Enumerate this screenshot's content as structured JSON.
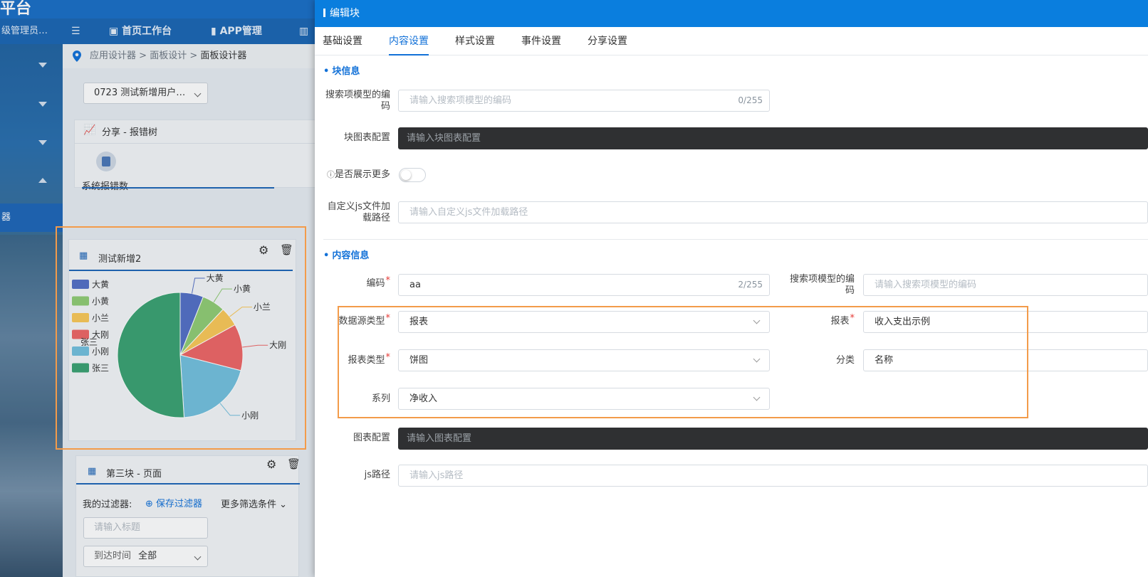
{
  "background": {
    "logo_fragment": "平台",
    "user_label": "级管理员…",
    "nav": [
      "首页工作台",
      "APP管理"
    ],
    "sidebar_selected": "器",
    "breadcrumb": [
      "应用设计器",
      ">",
      "面板设计",
      ">",
      "面板设计器"
    ],
    "app_select": "0723 测试新增用户…",
    "share_card": {
      "title": "分享 - 报错树",
      "item_label": "系统报错数"
    },
    "pie_card": {
      "title": "测试新增2"
    },
    "third_card": {
      "title": "第三块 - 页面",
      "filter_label": "我的过滤器:",
      "save_filter": "保存过滤器",
      "more_filter": "更多筛选条件",
      "title_placeholder": "请输入标题",
      "arrival_label": "到达时间",
      "arrival_value": "全部"
    }
  },
  "chart_data": {
    "type": "pie",
    "legend_placement": "left",
    "categories": [
      "大黄",
      "小黄",
      "小兰",
      "大刚",
      "小刚",
      "张三"
    ],
    "legend_labels": [
      "大黄",
      "小黄",
      "小兰",
      "大刚",
      "小刚",
      "张三"
    ],
    "overlap_label": "张三",
    "values": [
      6,
      6,
      5,
      12,
      20,
      51
    ],
    "colors": [
      "#5470c6",
      "#91cc75",
      "#fac858",
      "#ee6666",
      "#73c0de",
      "#3ba272"
    ]
  },
  "drawer": {
    "title": "编辑块",
    "tabs": [
      "基础设置",
      "内容设置",
      "样式设置",
      "事件设置",
      "分享设置"
    ],
    "active_tab": 1,
    "section_block": "块信息",
    "section_content": "内容信息",
    "fields": {
      "search_model_code": {
        "label": "搜索项模型的编码",
        "placeholder": "请输入搜索项模型的编码",
        "count": "0/255"
      },
      "chart_config": {
        "label": "块图表配置",
        "placeholder": "请输入块图表配置"
      },
      "show_more": {
        "label": "是否展示更多",
        "value": false
      },
      "custom_js": {
        "label": "自定义js文件加载路径",
        "placeholder": "请输入自定义js文件加载路径"
      },
      "code": {
        "label": "编码",
        "value": "aa",
        "count": "2/255"
      },
      "search_model_code2": {
        "label": "搜索项模型的编码",
        "placeholder": "请输入搜索项模型的编码"
      },
      "datasource_type": {
        "label": "数据源类型",
        "value": "报表"
      },
      "report": {
        "label": "报表",
        "value": "收入支出示例"
      },
      "report_type": {
        "label": "报表类型",
        "value": "饼图"
      },
      "category": {
        "label": "分类",
        "value": "名称"
      },
      "series": {
        "label": "系列",
        "value": "净收入"
      },
      "chart_config2": {
        "label": "图表配置",
        "placeholder": "请输入图表配置"
      },
      "js_path": {
        "label": "js路径",
        "placeholder": "请输入js路径"
      }
    }
  }
}
